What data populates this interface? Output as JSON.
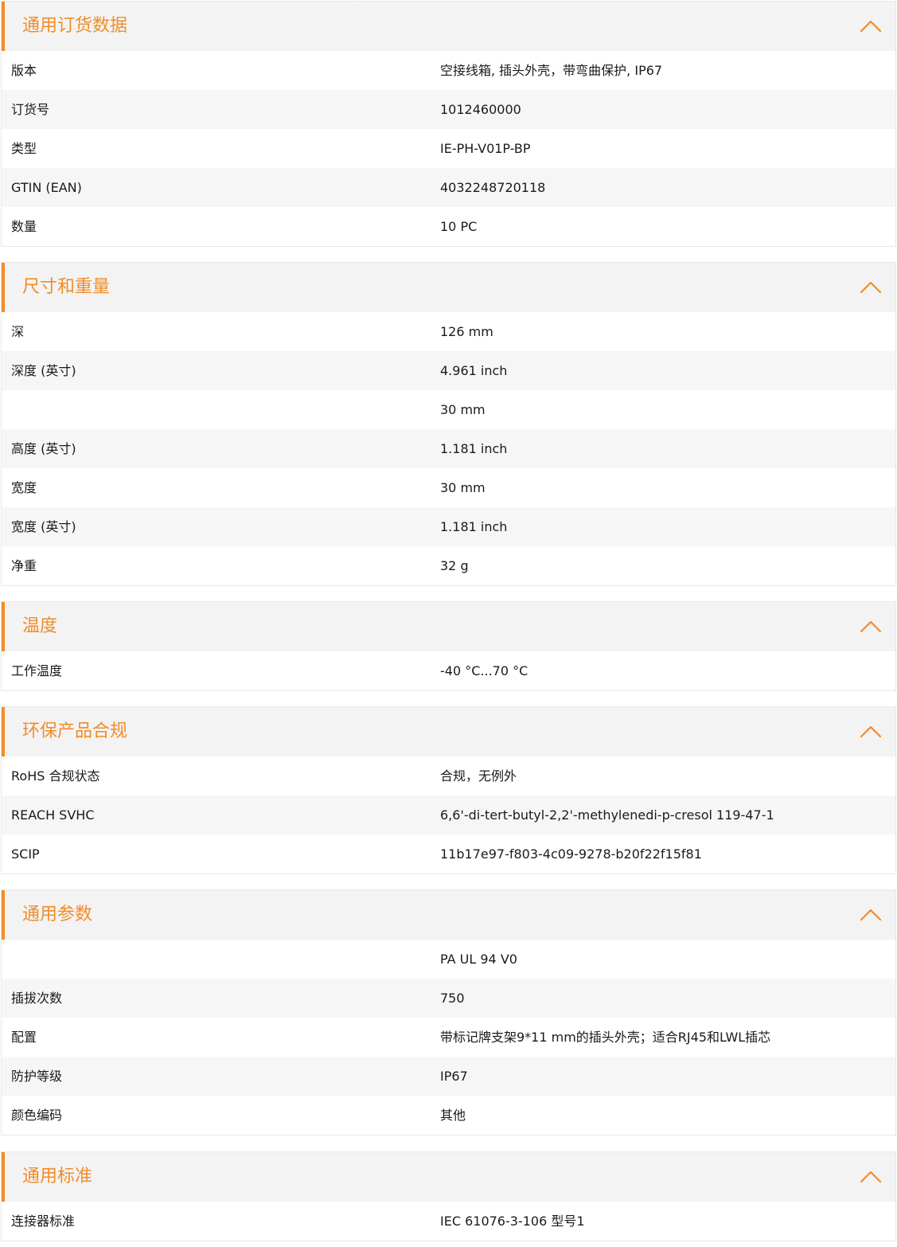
{
  "accent_color": "#f28c28",
  "collapse_icon": "chevron-up-icon",
  "sections": [
    {
      "title": "通用订货数据",
      "rows": [
        {
          "label": "版本",
          "value": "空接线箱, 插头外壳，带弯曲保护, IP67"
        },
        {
          "label": "订货号",
          "value": "1012460000"
        },
        {
          "label": "类型",
          "value": "IE-PH-V01P-BP"
        },
        {
          "label": "GTIN (EAN)",
          "value": "4032248720118"
        },
        {
          "label": "数量",
          "value": "10  PC"
        }
      ]
    },
    {
      "title": "尺寸和重量",
      "rows": [
        {
          "label": "深",
          "value": "126  mm"
        },
        {
          "label": "深度 (英寸)",
          "value": "4.961  inch"
        },
        {
          "label": "",
          "value": "30  mm"
        },
        {
          "label": "高度 (英寸)",
          "value": "1.181  inch"
        },
        {
          "label": "宽度",
          "value": "30  mm"
        },
        {
          "label": "宽度 (英寸)",
          "value": "1.181  inch"
        },
        {
          "label": "净重",
          "value": "32  g"
        }
      ]
    },
    {
      "title": "温度",
      "rows": [
        {
          "label": "工作温度",
          "value": "-40 °C...70 °C"
        }
      ]
    },
    {
      "title": "环保产品合规",
      "rows": [
        {
          "label": "RoHS 合规状态",
          "value": "合规，无例外"
        },
        {
          "label": "REACH SVHC",
          "value": "6,6'-di-tert-butyl-2,2'-methylenedi-p-cresol 119-47-1"
        },
        {
          "label": "SCIP",
          "value": "11b17e97-f803-4c09-9278-b20f22f15f81"
        }
      ]
    },
    {
      "title": "通用参数",
      "rows": [
        {
          "label": "",
          "value": "PA UL 94 V0"
        },
        {
          "label": "插拔次数",
          "value": "750"
        },
        {
          "label": "配置",
          "value": "带标记牌支架9*11 mm的插头外壳；适合RJ45和LWL插芯"
        },
        {
          "label": "防护等级",
          "value": "IP67"
        },
        {
          "label": "颜色编码",
          "value": "其他"
        }
      ]
    },
    {
      "title": "通用标准",
      "rows": [
        {
          "label": "连接器标准",
          "value": "IEC 61076-3-106 型号1"
        }
      ]
    }
  ]
}
